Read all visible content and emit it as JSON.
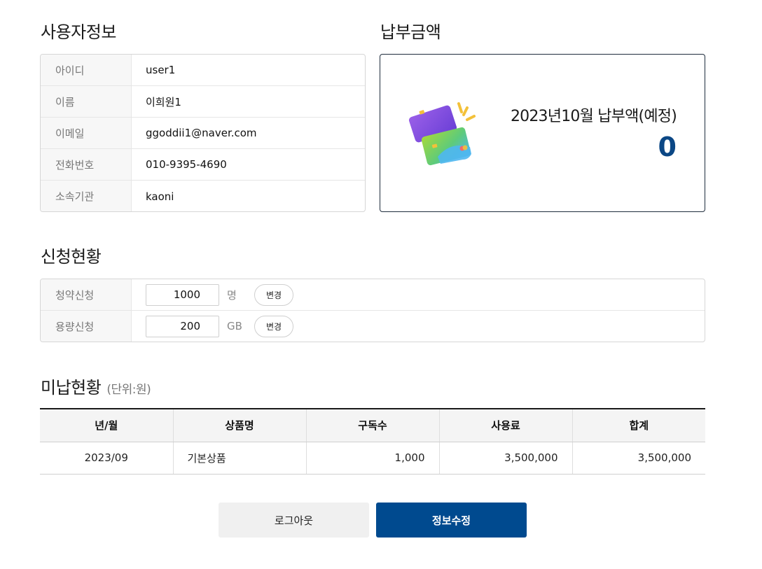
{
  "user_info": {
    "title": "사용자정보",
    "rows": [
      {
        "label": "아이디",
        "value": "user1"
      },
      {
        "label": "이름",
        "value": "이희원1"
      },
      {
        "label": "이메일",
        "value": "ggoddii1@naver.com"
      },
      {
        "label": "전화번호",
        "value": "010-9395-4690"
      },
      {
        "label": "소속기관",
        "value": "kaoni"
      }
    ]
  },
  "payment": {
    "title": "납부금액",
    "label": "2023년10월 납부액(예정)",
    "amount": "0",
    "accent_color": "#0b4785"
  },
  "application": {
    "title": "신청현황",
    "rows": [
      {
        "label": "청약신청",
        "value": "1000",
        "unit": "명",
        "button": "변경"
      },
      {
        "label": "용량신청",
        "value": "200",
        "unit": "GB",
        "button": "변경"
      }
    ]
  },
  "unpaid": {
    "title": "미납현황",
    "unit_note": "(단위:원)",
    "headers": [
      "년/월",
      "상품명",
      "구독수",
      "사용료",
      "합계"
    ],
    "rows": [
      [
        "2023/09",
        "기본상품",
        "1,000",
        "3,500,000",
        "3,500,000"
      ]
    ]
  },
  "buttons": {
    "logout": "로그아웃",
    "edit": "정보수정",
    "primary_color": "#004a8f"
  }
}
